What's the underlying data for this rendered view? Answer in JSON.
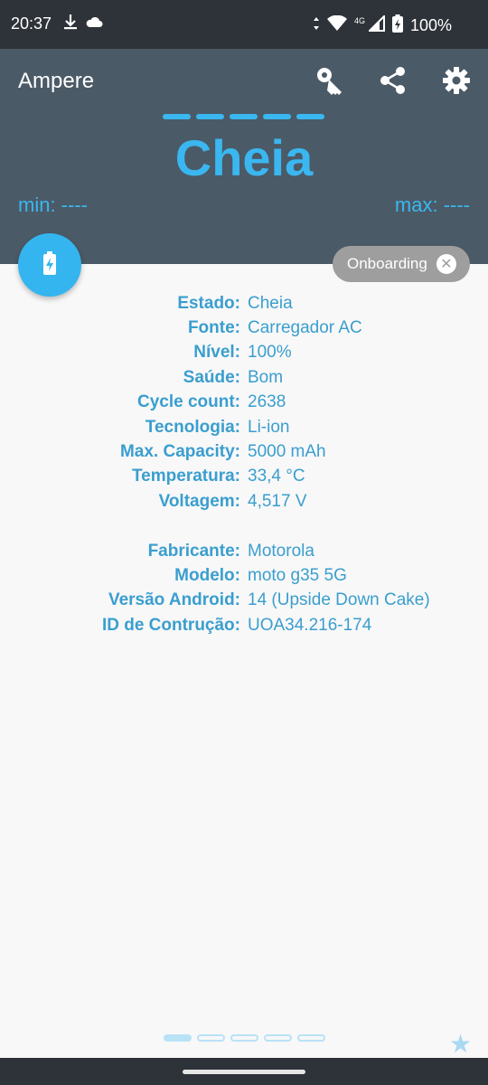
{
  "status_bar": {
    "time": "20:37",
    "battery_percent": "100%",
    "network": "4G",
    "icons": [
      "download-icon",
      "cloud-icon",
      "data-arrows-icon",
      "wifi-icon",
      "signal-icon",
      "battery-charging-icon"
    ]
  },
  "header": {
    "app_title": "Ampere",
    "status": "Cheia",
    "min_label": "min: ----",
    "max_label": "max: ----",
    "icons": [
      "key-icon",
      "share-icon",
      "gear-icon"
    ],
    "level_fraction": 1.0
  },
  "chip": {
    "label": "Onboarding"
  },
  "battery_info": [
    {
      "label": "Estado:",
      "value": "Cheia"
    },
    {
      "label": "Fonte:",
      "value": "Carregador AC"
    },
    {
      "label": "Nível:",
      "value": "100%"
    },
    {
      "label": "Saúde:",
      "value": "Bom"
    },
    {
      "label": "Cycle count:",
      "value": "2638"
    },
    {
      "label": "Tecnologia:",
      "value": "Li-ion"
    },
    {
      "label": "Max. Capacity:",
      "value": "5000 mAh"
    },
    {
      "label": "Temperatura:",
      "value": "33,4 °C"
    },
    {
      "label": "Voltagem:",
      "value": "4,517 V"
    }
  ],
  "device_info": [
    {
      "label": "Fabricante:",
      "value": "Motorola"
    },
    {
      "label": "Modelo:",
      "value": "moto g35 5G"
    },
    {
      "label": "Versão Android:",
      "value": "14 (Upside Down Cake)"
    },
    {
      "label": "ID de Contrução:",
      "value": "UOA34.216-174"
    }
  ],
  "pager": {
    "pages": 5,
    "active_index": 0
  },
  "colors": {
    "accent": "#3ab7f0",
    "header_bg": "#4b5a67",
    "system_bar": "#2d3338",
    "text_blue": "#3a9ecf",
    "chip_bg": "#9e9e9e"
  }
}
